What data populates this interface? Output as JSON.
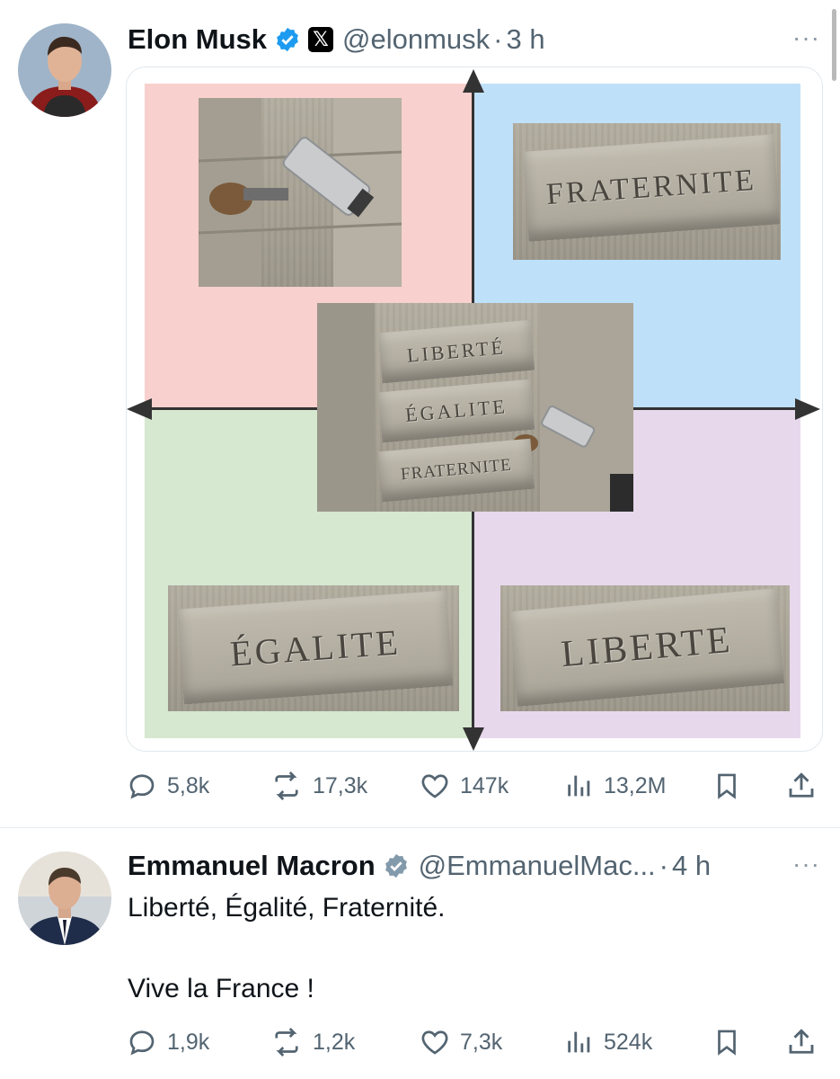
{
  "tweets": [
    {
      "author_name": "Elon Musk",
      "handle": "@elonmusk",
      "separator": "·",
      "time": "3 h",
      "badge_x": "𝕏",
      "more": "···",
      "media": {
        "plaques": {
          "top_right": "FRATERNITE",
          "bottom_left": "ÉGALITE",
          "bottom_right": "LIBERTE",
          "center": [
            "LIBERTÉ",
            "ÉGALITE",
            "FRATERNITE"
          ]
        },
        "quadrant_colors": {
          "top_left": "#f8d0cd",
          "top_right": "#bfe0f9",
          "bottom_left": "#d6e8cf",
          "bottom_right": "#e8d8ec"
        }
      },
      "stats": {
        "replies": "5,8k",
        "reposts": "17,3k",
        "likes": "147k",
        "views": "13,2M"
      }
    },
    {
      "author_name": "Emmanuel Macron",
      "handle": "@EmmanuelMac...",
      "separator": "·",
      "time": "4 h",
      "more": "···",
      "text_line1": "Liberté, Égalité, Fraternité.",
      "text_line2": "Vive la France !",
      "stats": {
        "replies": "1,9k",
        "reposts": "1,2k",
        "likes": "7,3k",
        "views": "524k"
      }
    }
  ],
  "colors": {
    "verified": "#1d9bf0",
    "muted": "#536471",
    "text": "#0f1419"
  },
  "icons": [
    "reply-icon",
    "repost-icon",
    "like-icon",
    "views-icon",
    "bookmark-icon",
    "share-icon",
    "verified-badge-icon",
    "more-icon"
  ]
}
